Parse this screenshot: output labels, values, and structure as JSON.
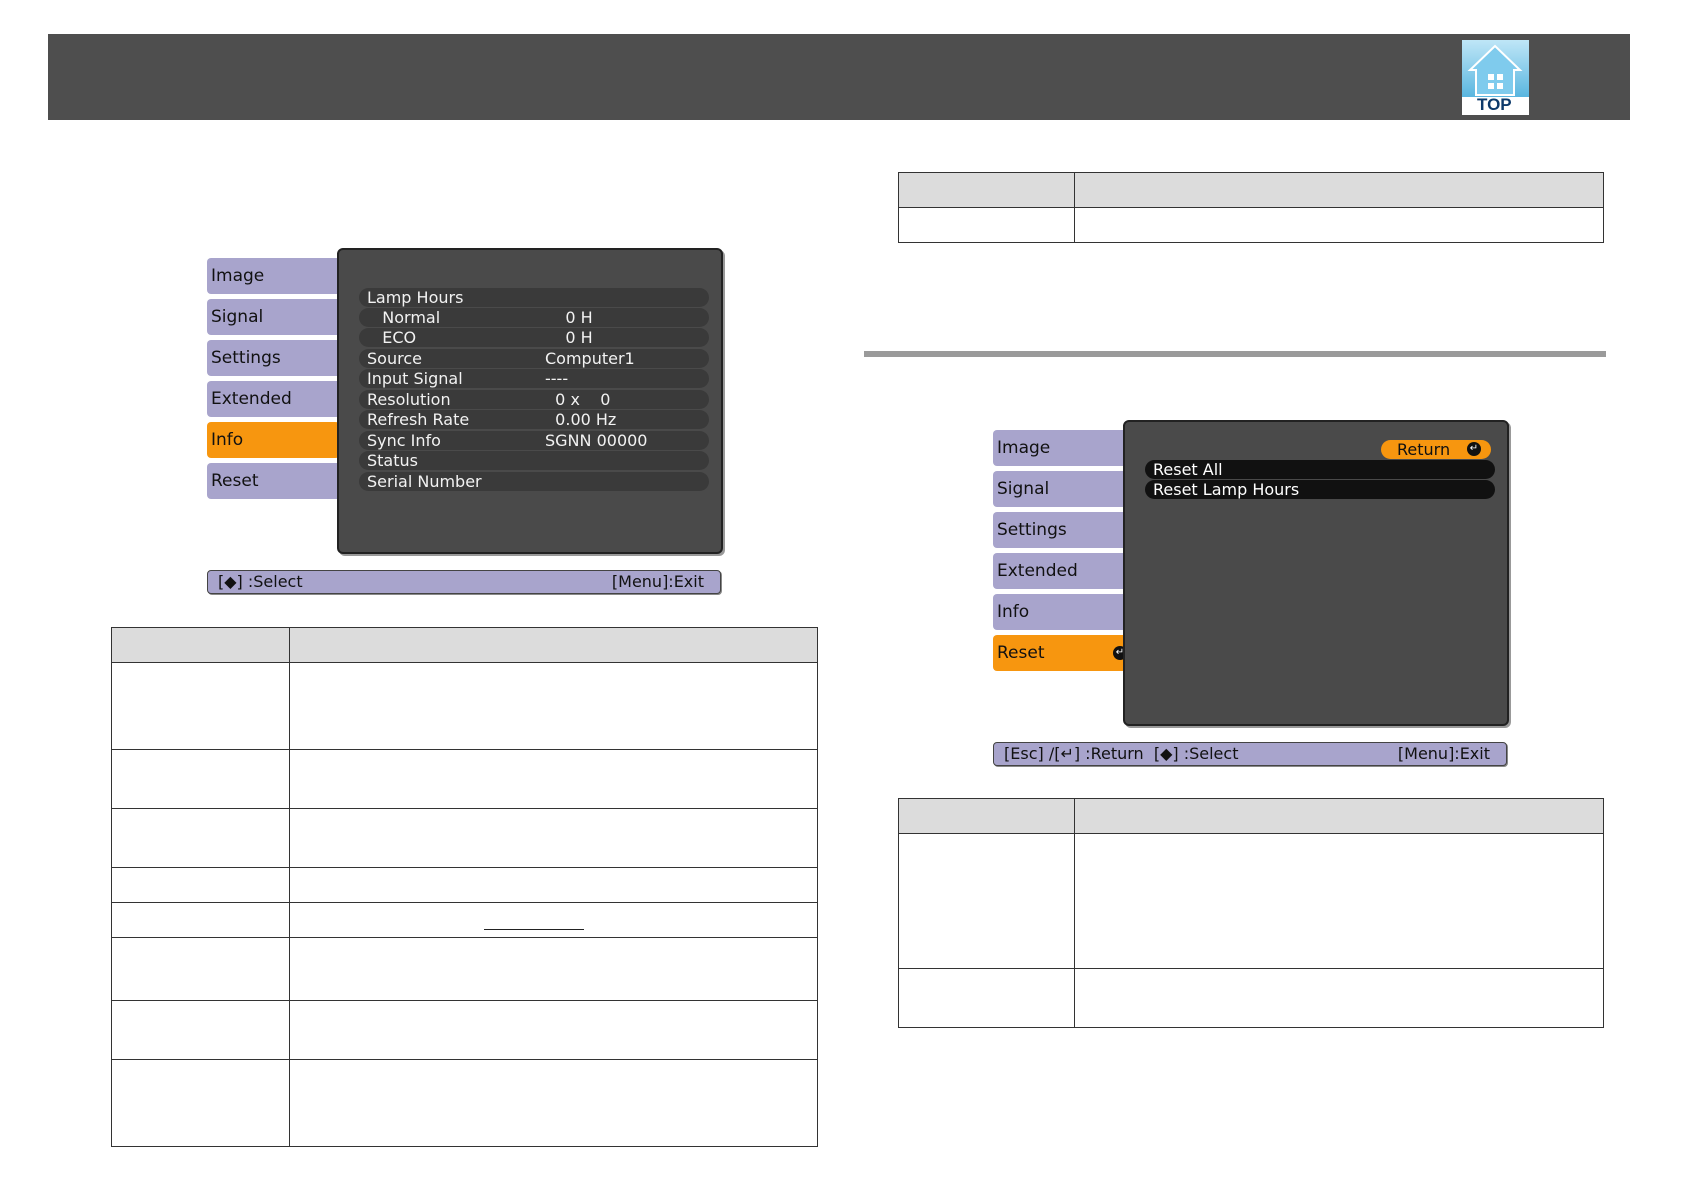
{
  "header": {
    "top_label": "TOP"
  },
  "info_menu": {
    "tabs": [
      "Image",
      "Signal",
      "Settings",
      "Extended",
      "Info",
      "Reset"
    ],
    "active_tab": "Info",
    "rows": [
      {
        "key": "Lamp Hours",
        "value": ""
      },
      {
        "key": "   Normal",
        "value": "    0 H"
      },
      {
        "key": "   ECO",
        "value": "    0 H"
      },
      {
        "key": "Source",
        "value": "Computer1"
      },
      {
        "key": "Input Signal",
        "value": "----"
      },
      {
        "key": "Resolution",
        "value": "  0 x    0"
      },
      {
        "key": "Refresh Rate",
        "value": "  0.00 Hz"
      },
      {
        "key": "Sync Info",
        "value": "SGNN 00000"
      },
      {
        "key": "Status",
        "value": ""
      },
      {
        "key": "Serial Number",
        "value": ""
      }
    ],
    "help_left": "[◆] :Select",
    "help_right": "[Menu]:Exit"
  },
  "reset_menu": {
    "tabs": [
      "Image",
      "Signal",
      "Settings",
      "Extended",
      "Info",
      "Reset"
    ],
    "active_tab": "Reset",
    "return_label": "Return",
    "rows": [
      "Reset All",
      "Reset Lamp Hours"
    ],
    "help_left": "[Esc] /[↵] :Return  [◆] :Select",
    "help_right": "[Menu]:Exit"
  },
  "colors": {
    "header": "#4e4e4e",
    "tab": "#a8a4cc",
    "active_tab": "#f7960f",
    "panel": "#4a4a4a",
    "table_header": "#dcdcdc"
  },
  "icons": {
    "top": "house-icon",
    "enter": "enter-icon"
  }
}
